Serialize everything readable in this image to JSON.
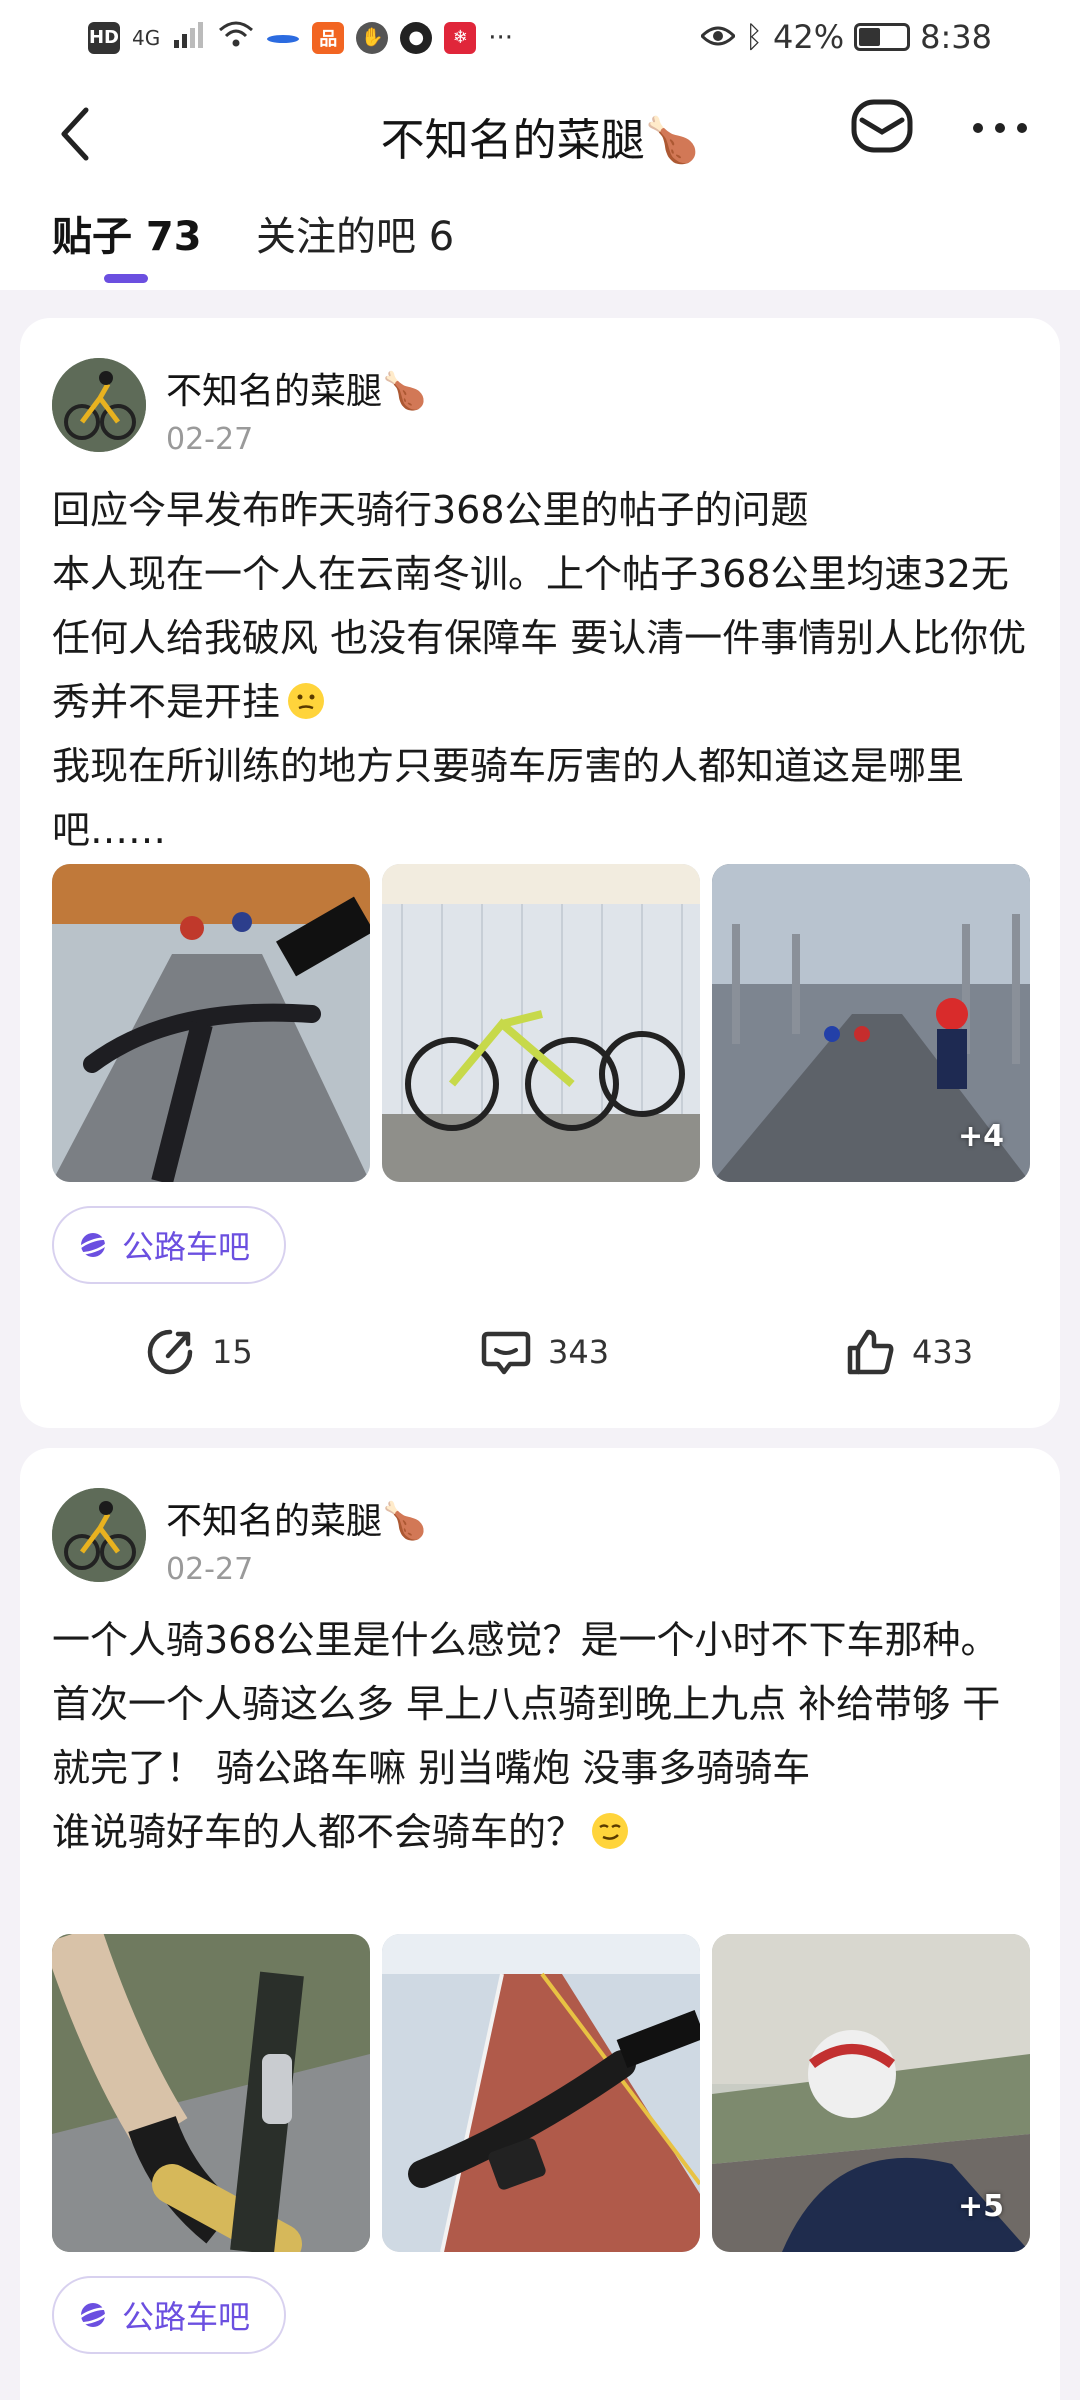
{
  "status_bar": {
    "left": [
      "HD",
      "4G"
    ],
    "battery": "42%",
    "time": "8:38"
  },
  "header": {
    "title": "不知名的菜腿🍗"
  },
  "tabs": [
    {
      "label": "贴子 73"
    },
    {
      "label": "关注的吧 6"
    }
  ],
  "posts": [
    {
      "author": "不知名的菜腿🍗",
      "date": "02-27",
      "paragraphs": [
        "回应今早发布昨天骑行368公里的帖子的问题",
        "本人现在一个人在云南冬训。上个帖子368公里均速32无任何人给我破风 也没有保障车 要认清一件事情别人比你优秀并不是开挂",
        "我现在所训练的地方只要骑车厉害的人都知道这是哪里吧……"
      ],
      "more_images": "+4",
      "forum": "公路车吧",
      "shares": "15",
      "comments": "343",
      "likes": "433"
    },
    {
      "author": "不知名的菜腿🍗",
      "date": "02-27",
      "paragraphs": [
        "一个人骑368公里是什么感觉？是一个小时不下车那种。",
        "首次一个人骑这么多 早上八点骑到晚上九点 补给带够 干就完了！ 骑公路车嘛 别当嘴炮 没事多骑骑车",
        "谁说骑好车的人都不会骑车的？"
      ],
      "more_images": "+5",
      "forum": "公路车吧"
    }
  ],
  "colors": {
    "accent": "#6b4fe0",
    "background": "#f4f2f7"
  },
  "icons": [
    "back-icon",
    "mail-icon",
    "more-icon",
    "share-icon",
    "comment-icon",
    "like-icon",
    "forum-planet-icon"
  ]
}
